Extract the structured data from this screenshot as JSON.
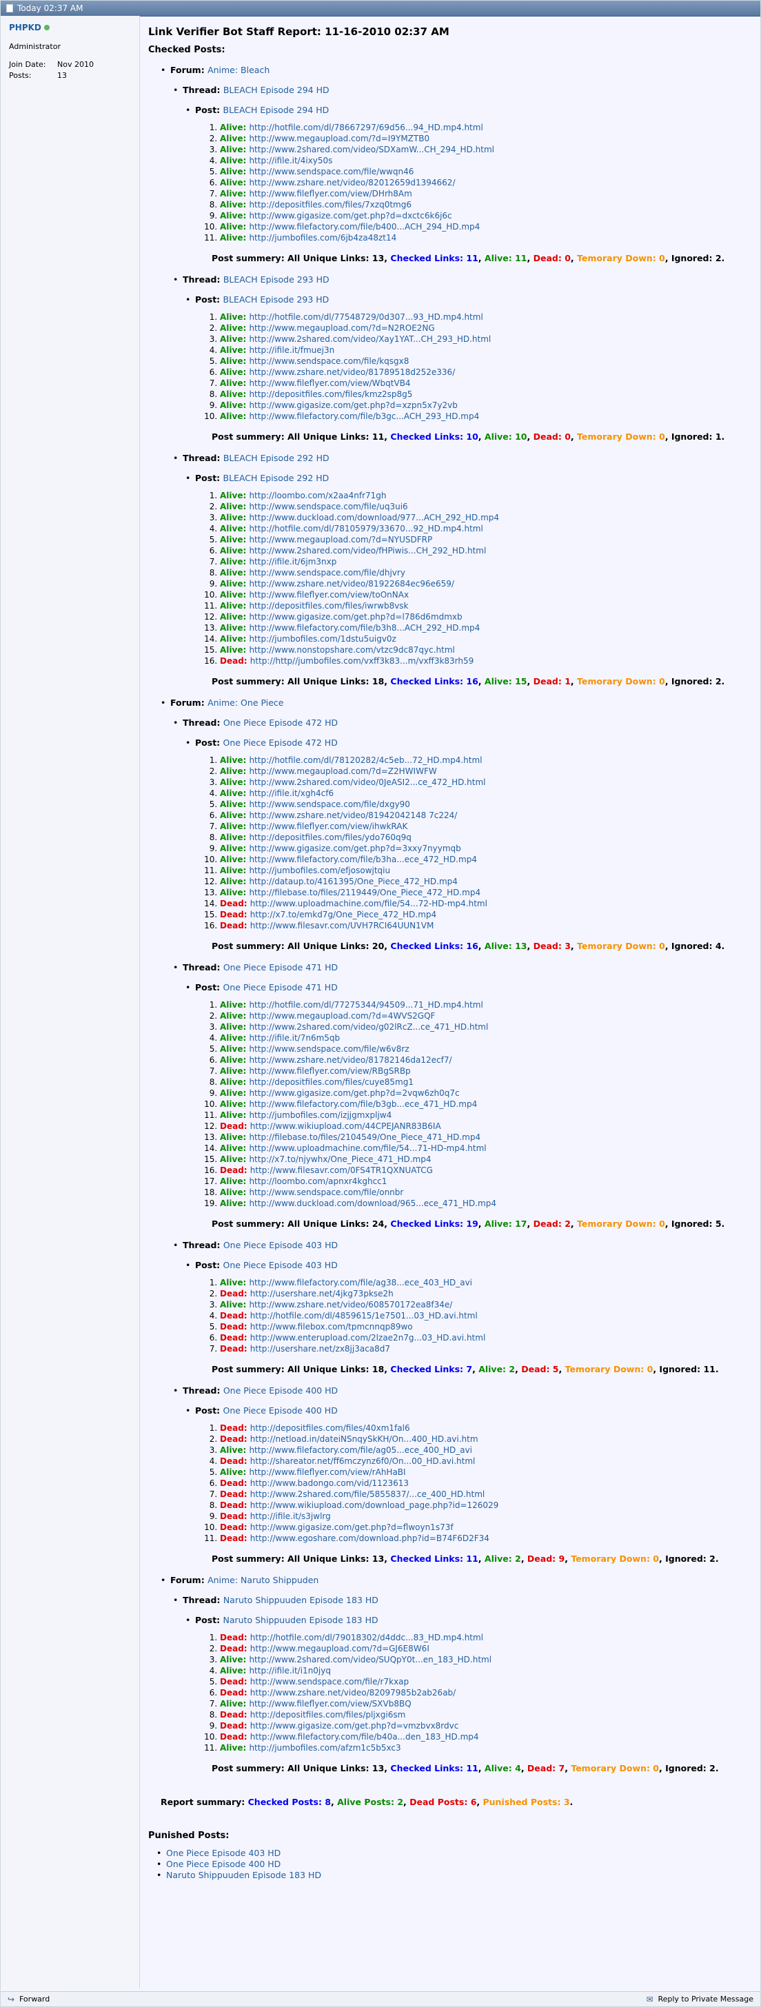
{
  "header": {
    "datetime": "Today 02:37 AM"
  },
  "user": {
    "name": "PHPKD",
    "title": "Administrator",
    "join_label": "Join Date:",
    "join_value": "Nov 2010",
    "posts_label": "Posts:",
    "posts_value": "13"
  },
  "report": {
    "title": "Link Verifier Bot Staff Report: 11-16-2010 02:37 AM",
    "checked_heading": "Checked Posts:",
    "forum_label": "Forum:",
    "thread_label": "Thread:",
    "post_label": "Post:",
    "alive_label": "Alive:",
    "dead_label": "Dead:",
    "forums": [
      {
        "name": "Anime: Bleach",
        "threads": [
          {
            "name": "BLEACH Episode 294 HD",
            "post": "BLEACH Episode 294 HD",
            "links": [
              {
                "s": "alive",
                "url": "http://hotfile.com/dl/78667297/69d56...94_HD.mp4.html"
              },
              {
                "s": "alive",
                "url": "http://www.megaupload.com/?d=I9YMZTB0"
              },
              {
                "s": "alive",
                "url": "http://www.2shared.com/video/SDXamW...CH_294_HD.html"
              },
              {
                "s": "alive",
                "url": "http://ifile.it/4ixy50s"
              },
              {
                "s": "alive",
                "url": "http://www.sendspace.com/file/wwqn46"
              },
              {
                "s": "alive",
                "url": "http://www.zshare.net/video/82012659d1394662/"
              },
              {
                "s": "alive",
                "url": "http://www.fileflyer.com/view/DHrh8Am"
              },
              {
                "s": "alive",
                "url": "http://depositfiles.com/files/7xzq0tmg6"
              },
              {
                "s": "alive",
                "url": "http://www.gigasize.com/get.php?d=dxctc6k6j6c"
              },
              {
                "s": "alive",
                "url": "http://www.filefactory.com/file/b400...ACH_294_HD.mp4"
              },
              {
                "s": "alive",
                "url": "http://jumbofiles.com/6jb4za48zt14"
              }
            ],
            "summary": {
              "unique": "13",
              "checked": "11",
              "alive": "11",
              "dead": "0",
              "down": "0",
              "ignored": "2"
            }
          },
          {
            "name": "BLEACH Episode 293 HD",
            "post": "BLEACH Episode 293 HD",
            "links": [
              {
                "s": "alive",
                "url": "http://hotfile.com/dl/77548729/0d307...93_HD.mp4.html"
              },
              {
                "s": "alive",
                "url": "http://www.megaupload.com/?d=N2ROE2NG"
              },
              {
                "s": "alive",
                "url": "http://www.2shared.com/video/Xay1YAT...CH_293_HD.html"
              },
              {
                "s": "alive",
                "url": "http://ifile.it/fmuej3n"
              },
              {
                "s": "alive",
                "url": "http://www.sendspace.com/file/kqsgx8"
              },
              {
                "s": "alive",
                "url": "http://www.zshare.net/video/81789518d252e336/"
              },
              {
                "s": "alive",
                "url": "http://www.fileflyer.com/view/WbqtVB4"
              },
              {
                "s": "alive",
                "url": "http://depositfiles.com/files/kmz2sp8g5"
              },
              {
                "s": "alive",
                "url": "http://www.gigasize.com/get.php?d=xzpn5x7y2vb"
              },
              {
                "s": "alive",
                "url": "http://www.filefactory.com/file/b3gc...ACH_293_HD.mp4"
              }
            ],
            "summary": {
              "unique": "11",
              "checked": "10",
              "alive": "10",
              "dead": "0",
              "down": "0",
              "ignored": "1"
            }
          },
          {
            "name": "BLEACH Episode 292 HD",
            "post": "BLEACH Episode 292 HD",
            "links": [
              {
                "s": "alive",
                "url": "http://loombo.com/x2aa4nfr71gh"
              },
              {
                "s": "alive",
                "url": "http://www.sendspace.com/file/uq3ui6"
              },
              {
                "s": "alive",
                "url": "http://www.duckload.com/download/977...ACH_292_HD.mp4"
              },
              {
                "s": "alive",
                "url": "http://hotfile.com/dl/78105979/33670...92_HD.mp4.html"
              },
              {
                "s": "alive",
                "url": "http://www.megaupload.com/?d=NYUSDFRP"
              },
              {
                "s": "alive",
                "url": "http://www.2shared.com/video/fHPiwis...CH_292_HD.html"
              },
              {
                "s": "alive",
                "url": "http://ifile.it/6jm3nxp"
              },
              {
                "s": "alive",
                "url": "http://www.sendspace.com/file/dhjvry"
              },
              {
                "s": "alive",
                "url": "http://www.zshare.net/video/81922684ec96e659/"
              },
              {
                "s": "alive",
                "url": "http://www.fileflyer.com/view/toOnNAx"
              },
              {
                "s": "alive",
                "url": "http://depositfiles.com/files/iwrwb8vsk"
              },
              {
                "s": "alive",
                "url": "http://www.gigasize.com/get.php?d=l786d6mdmxb"
              },
              {
                "s": "alive",
                "url": "http://www.filefactory.com/file/b3h8...ACH_292_HD.mp4"
              },
              {
                "s": "alive",
                "url": "http://jumbofiles.com/1dstu5uigv0z"
              },
              {
                "s": "alive",
                "url": "http://www.nonstopshare.com/vtzc9dc87qyc.html"
              },
              {
                "s": "dead",
                "url": "http://http//jumbofiles.com/vxff3k83...m/vxff3k83rh59"
              }
            ],
            "summary": {
              "unique": "18",
              "checked": "16",
              "alive": "15",
              "dead": "1",
              "down": "0",
              "ignored": "2"
            }
          }
        ]
      },
      {
        "name": "Anime: One Piece",
        "threads": [
          {
            "name": "One Piece Episode 472 HD",
            "post": "One Piece Episode 472 HD",
            "links": [
              {
                "s": "alive",
                "url": "http://hotfile.com/dl/78120282/4c5eb...72_HD.mp4.html"
              },
              {
                "s": "alive",
                "url": "http://www.megaupload.com/?d=Z2HWIWFW"
              },
              {
                "s": "alive",
                "url": "http://www.2shared.com/video/0JeASI2...ce_472_HD.html"
              },
              {
                "s": "alive",
                "url": "http://ifile.it/xgh4cf6"
              },
              {
                "s": "alive",
                "url": "http://www.sendspace.com/file/dxgy90"
              },
              {
                "s": "alive",
                "url": "http://www.zshare.net/video/81942042148 7c224/"
              },
              {
                "s": "alive",
                "url": "http://www.fileflyer.com/view/ihwkRAK"
              },
              {
                "s": "alive",
                "url": "http://depositfiles.com/files/ydo760q9q"
              },
              {
                "s": "alive",
                "url": "http://www.gigasize.com/get.php?d=3xxy7nyymqb"
              },
              {
                "s": "alive",
                "url": "http://www.filefactory.com/file/b3ha...ece_472_HD.mp4"
              },
              {
                "s": "alive",
                "url": "http://jumbofiles.com/efjosowjtqiu"
              },
              {
                "s": "alive",
                "url": "http://dataup.to/4161395/One_Piece_472_HD.mp4"
              },
              {
                "s": "alive",
                "url": "http://filebase.to/files/2119449/One_Piece_472_HD.mp4"
              },
              {
                "s": "dead",
                "url": "http://www.uploadmachine.com/file/54...72-HD-mp4.html"
              },
              {
                "s": "dead",
                "url": "http://x7.to/emkd7g/One_Piece_472_HD.mp4"
              },
              {
                "s": "dead",
                "url": "http://www.filesavr.com/UVH7RCI64UUN1VM"
              }
            ],
            "summary": {
              "unique": "20",
              "checked": "16",
              "alive": "13",
              "dead": "3",
              "down": "0",
              "ignored": "4"
            }
          },
          {
            "name": "One Piece Episode 471 HD",
            "post": "One Piece Episode 471 HD",
            "links": [
              {
                "s": "alive",
                "url": "http://hotfile.com/dl/77275344/94509...71_HD.mp4.html"
              },
              {
                "s": "alive",
                "url": "http://www.megaupload.com/?d=4WVS2GQF"
              },
              {
                "s": "alive",
                "url": "http://www.2shared.com/video/g02lRcZ...ce_471_HD.html"
              },
              {
                "s": "alive",
                "url": "http://ifile.it/7n6m5qb"
              },
              {
                "s": "alive",
                "url": "http://www.sendspace.com/file/w6v8rz"
              },
              {
                "s": "alive",
                "url": "http://www.zshare.net/video/81782146da12ecf7/"
              },
              {
                "s": "alive",
                "url": "http://www.fileflyer.com/view/RBgSRBp"
              },
              {
                "s": "alive",
                "url": "http://depositfiles.com/files/cuye85mg1"
              },
              {
                "s": "alive",
                "url": "http://www.gigasize.com/get.php?d=2vqw6zh0q7c"
              },
              {
                "s": "alive",
                "url": "http://www.filefactory.com/file/b3gb...ece_471_HD.mp4"
              },
              {
                "s": "alive",
                "url": "http://jumbofiles.com/izjjgmxpljw4"
              },
              {
                "s": "dead",
                "url": "http://www.wikiupload.com/44CPEJANR83B6IA"
              },
              {
                "s": "alive",
                "url": "http://filebase.to/files/2104549/One_Piece_471_HD.mp4"
              },
              {
                "s": "alive",
                "url": "http://www.uploadmachine.com/file/54...71-HD-mp4.html"
              },
              {
                "s": "alive",
                "url": "http://x7.to/njywhx/One_Piece_471_HD.mp4"
              },
              {
                "s": "dead",
                "url": "http://www.filesavr.com/0FS4TR1QXNUATCG"
              },
              {
                "s": "alive",
                "url": "http://loombo.com/apnxr4kghcc1"
              },
              {
                "s": "alive",
                "url": "http://www.sendspace.com/file/onnbr"
              },
              {
                "s": "alive",
                "url": "http://www.duckload.com/download/965...ece_471_HD.mp4"
              }
            ],
            "summary": {
              "unique": "24",
              "checked": "19",
              "alive": "17",
              "dead": "2",
              "down": "0",
              "ignored": "5"
            }
          },
          {
            "name": "One Piece Episode 403 HD",
            "post": "One Piece Episode 403 HD",
            "links": [
              {
                "s": "alive",
                "url": "http://www.filefactory.com/file/ag38...ece_403_HD_avi"
              },
              {
                "s": "dead",
                "url": "http://usershare.net/4jkg73pkse2h"
              },
              {
                "s": "alive",
                "url": "http://www.zshare.net/video/608570172ea8f34e/"
              },
              {
                "s": "dead",
                "url": "http://hotfile.com/dl/4859615/1e7501...03_HD.avi.html"
              },
              {
                "s": "dead",
                "url": "http://www.filebox.com/tpmcnnqp89wo"
              },
              {
                "s": "dead",
                "url": "http://www.enterupload.com/2lzae2n7g...03_HD.avi.html"
              },
              {
                "s": "dead",
                "url": "http://usershare.net/zx8jj3aca8d7"
              }
            ],
            "summary": {
              "unique": "18",
              "checked": "7",
              "alive": "2",
              "dead": "5",
              "down": "0",
              "ignored": "11"
            }
          },
          {
            "name": "One Piece Episode 400 HD",
            "post": "One Piece Episode 400 HD",
            "links": [
              {
                "s": "dead",
                "url": "http://depositfiles.com/files/40xm1fal6"
              },
              {
                "s": "dead",
                "url": "http://netload.in/dateiNSnqySkKH/On...400_HD.avi.htm"
              },
              {
                "s": "alive",
                "url": "http://www.filefactory.com/file/ag05...ece_400_HD_avi"
              },
              {
                "s": "dead",
                "url": "http://shareator.net/ff6mczynz6f0/On...00_HD.avi.html"
              },
              {
                "s": "alive",
                "url": "http://www.fileflyer.com/view/rAhHaBI"
              },
              {
                "s": "dead",
                "url": "http://www.badongo.com/vid/1123613"
              },
              {
                "s": "dead",
                "url": "http://www.2shared.com/file/5855837/...ce_400_HD.html"
              },
              {
                "s": "dead",
                "url": "http://www.wikiupload.com/download_page.php?id=126029"
              },
              {
                "s": "dead",
                "url": "http://ifile.it/s3jwlrg"
              },
              {
                "s": "dead",
                "url": "http://www.gigasize.com/get.php?d=flwoyn1s73f"
              },
              {
                "s": "dead",
                "url": "http://www.egoshare.com/download.php?id=B74F6D2F34"
              }
            ],
            "summary": {
              "unique": "13",
              "checked": "11",
              "alive": "2",
              "dead": "9",
              "down": "0",
              "ignored": "2"
            }
          }
        ]
      },
      {
        "name": "Anime: Naruto Shippuden",
        "threads": [
          {
            "name": "Naruto Shippuuden Episode 183 HD",
            "post": "Naruto Shippuuden Episode 183 HD",
            "links": [
              {
                "s": "dead",
                "url": "http://hotfile.com/dl/79018302/d4ddc...83_HD.mp4.html"
              },
              {
                "s": "dead",
                "url": "http://www.megaupload.com/?d=GJ6E8W6I"
              },
              {
                "s": "alive",
                "url": "http://www.2shared.com/video/SUQpY0t...en_183_HD.html"
              },
              {
                "s": "alive",
                "url": "http://ifile.it/i1n0jyq"
              },
              {
                "s": "dead",
                "url": "http://www.sendspace.com/file/r7kxap"
              },
              {
                "s": "dead",
                "url": "http://www.zshare.net/video/82097985b2ab26ab/"
              },
              {
                "s": "alive",
                "url": "http://www.fileflyer.com/view/SXVb8BQ"
              },
              {
                "s": "dead",
                "url": "http://depositfiles.com/files/pljxgi6sm"
              },
              {
                "s": "dead",
                "url": "http://www.gigasize.com/get.php?d=vmzbvx8rdvc"
              },
              {
                "s": "dead",
                "url": "http://www.filefactory.com/file/b40a...den_183_HD.mp4"
              },
              {
                "s": "alive",
                "url": "http://jumbofiles.com/afzm1c5b5xc3"
              }
            ],
            "summary": {
              "unique": "13",
              "checked": "11",
              "alive": "4",
              "dead": "7",
              "down": "0",
              "ignored": "2"
            }
          }
        ]
      }
    ],
    "summary_labels": {
      "post_summary": "Post summery: All Unique Links:",
      "checked": "Checked Links:",
      "alive": "Alive:",
      "dead": "Dead:",
      "down": "Temorary Down:",
      "ignored": "Ignored:"
    },
    "final": {
      "label": "Report summary:",
      "checked_label": "Checked Posts:",
      "checked": "8",
      "alive_label": "Alive Posts:",
      "alive": "2",
      "dead_label": "Dead Posts:",
      "dead": "6",
      "punished_label": "Punished Posts:",
      "punished": "3"
    },
    "punished_heading": "Punished Posts:",
    "punished": [
      "One Piece Episode 403 HD",
      "One Piece Episode 400 HD",
      "Naruto Shippuuden Episode 183 HD"
    ]
  },
  "footer": {
    "forward": "Forward",
    "reply": "Reply to Private Message"
  },
  "colors": {
    "alive": "#0a8a00",
    "dead": "#e00000",
    "checked": "#0000ee",
    "down": "#f59200",
    "link": "#22609f"
  }
}
